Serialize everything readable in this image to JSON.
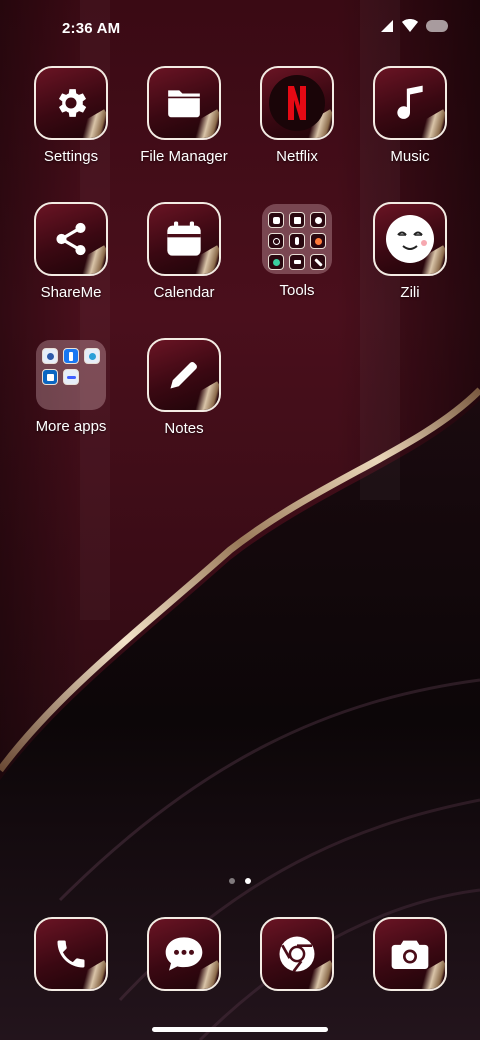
{
  "status": {
    "time": "2:36 AM",
    "icons": [
      "signal-icon",
      "wifi-icon",
      "battery-icon"
    ]
  },
  "apps": {
    "settings": "Settings",
    "file_manager": "File Manager",
    "netflix": "Netflix",
    "music": "Music",
    "shareme": "ShareMe",
    "calendar": "Calendar",
    "tools": "Tools",
    "zili": "Zili",
    "more_apps": "More apps",
    "notes": "Notes"
  },
  "dock": [
    "phone-icon",
    "messaging-icon",
    "chrome-icon",
    "camera-icon"
  ],
  "pages": {
    "count": 2,
    "active": 2
  },
  "colors": {
    "tile_border": "#f4ece4",
    "tile_fill": "#4a0c18",
    "netflix_red": "#e50914",
    "wallpaper_wine": "#4a0f1c"
  }
}
